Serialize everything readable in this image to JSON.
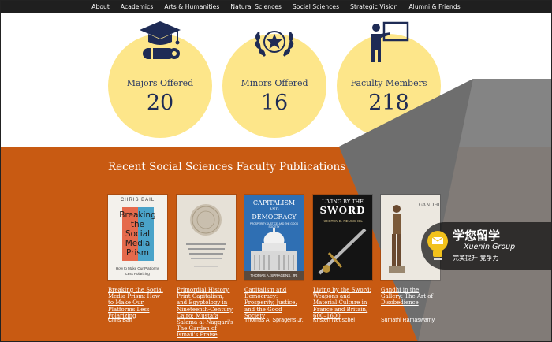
{
  "nav": {
    "items": [
      "About",
      "Academics",
      "Arts & Humanities",
      "Natural Sciences",
      "Social Sciences",
      "Strategic Vision",
      "Alumni & Friends"
    ]
  },
  "stats": [
    {
      "icon": "graduation-cap-diploma-icon",
      "label": "Majors Offered",
      "value": "20"
    },
    {
      "icon": "star-laurel-icon",
      "label": "Minors Offered",
      "value": "16"
    },
    {
      "icon": "teacher-board-icon",
      "label": "Faculty Members",
      "value": "218"
    }
  ],
  "publications": {
    "heading": "Recent Social Sciences Faculty Publications",
    "books": [
      {
        "title": "Breaking the Social Media Prism: How to Make Our Platforms Less Polarizing",
        "author": "Chris Bail",
        "cover_lines": [
          "CHRIS BAIL",
          "Breaking",
          "the",
          "Social",
          "Media",
          "Prism",
          "How to Make Our Platforms",
          "Less Polarizing"
        ]
      },
      {
        "title": "Primordial History, Print Capitalism, and Egyptology in Nineteenth-Century Cairo: Mustafa Salama al-Naggari's The Garden of Ismail's Praise",
        "author": "",
        "cover_lines": []
      },
      {
        "title": "Capitalism and Democracy: Prosperity, Justice, and the Good Society",
        "author": "Thomas A. Spragens Jr.",
        "cover_lines": [
          "CAPITALISM",
          "AND",
          "DEMOCRACY",
          "PROSPERITY, JUSTICE, AND THE GOOD SOCIETY",
          "THOMAS A. SPRAGENS, JR."
        ]
      },
      {
        "title": "Living by the Sword: Weapons and Material Culture in France and Britain, 600–1600",
        "author": "Kristen Neuschel",
        "cover_lines": [
          "LIVING BY THE",
          "SWORD",
          "KRISTEN B. NEUSCHEL"
        ]
      },
      {
        "title": "Gandhi in the Gallery: The Art of Disobedience",
        "author": "Sumathi Ramaswamy",
        "cover_lines": [
          "GANDHI"
        ]
      }
    ]
  },
  "watermark": {
    "cn": "学您留学",
    "en": "Xuenin Group",
    "sub": "完美提升  竞争力"
  },
  "colors": {
    "nav_bg": "#1f1f1f",
    "circle": "#fde68a",
    "navy": "#1e2b55",
    "orange": "#c85a12",
    "gray": "#7b7b7b"
  }
}
